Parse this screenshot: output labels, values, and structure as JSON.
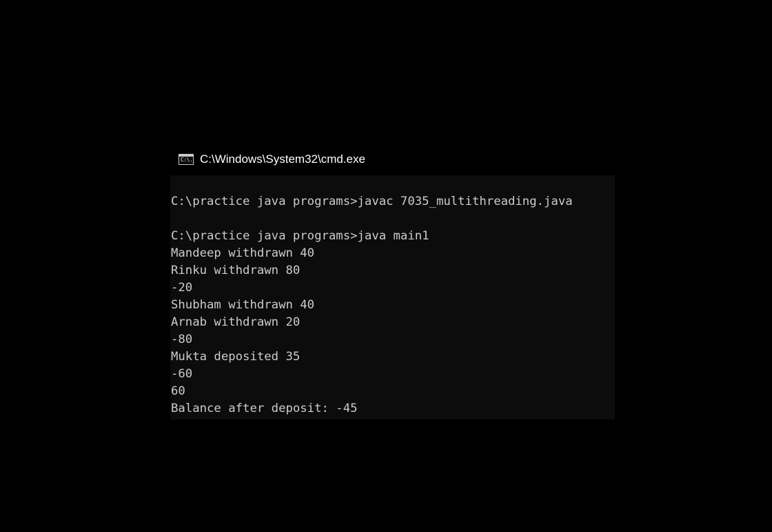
{
  "window": {
    "title": "C:\\Windows\\System32\\cmd.exe",
    "icon": "cmd-app-icon",
    "icon_glyph": "C:\\."
  },
  "console": {
    "background": "#0c0c0c",
    "text_color": "#cccccc",
    "lines": [
      "C:\\practice java programs>javac 7035_multithreading.java",
      "",
      "C:\\practice java programs>java main1",
      "Mandeep withdrawn 40",
      "Rinku withdrawn 80",
      "-20",
      "Shubham withdrawn 40",
      "Arnab withdrawn 20",
      "-80",
      "Mukta deposited 35",
      "-60",
      "60",
      "Balance after deposit: -45"
    ]
  }
}
